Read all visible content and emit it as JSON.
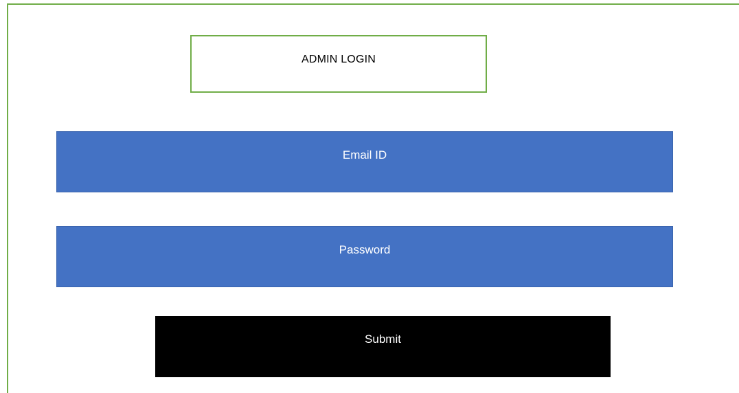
{
  "header": {
    "title": "ADMIN LOGIN"
  },
  "form": {
    "email_label": "Email ID",
    "password_label": "Password",
    "submit_label": "Submit"
  },
  "colors": {
    "frame_border": "#70ad47",
    "field_fill": "#4472c4",
    "submit_fill": "#000000",
    "field_text": "#ffffff"
  }
}
